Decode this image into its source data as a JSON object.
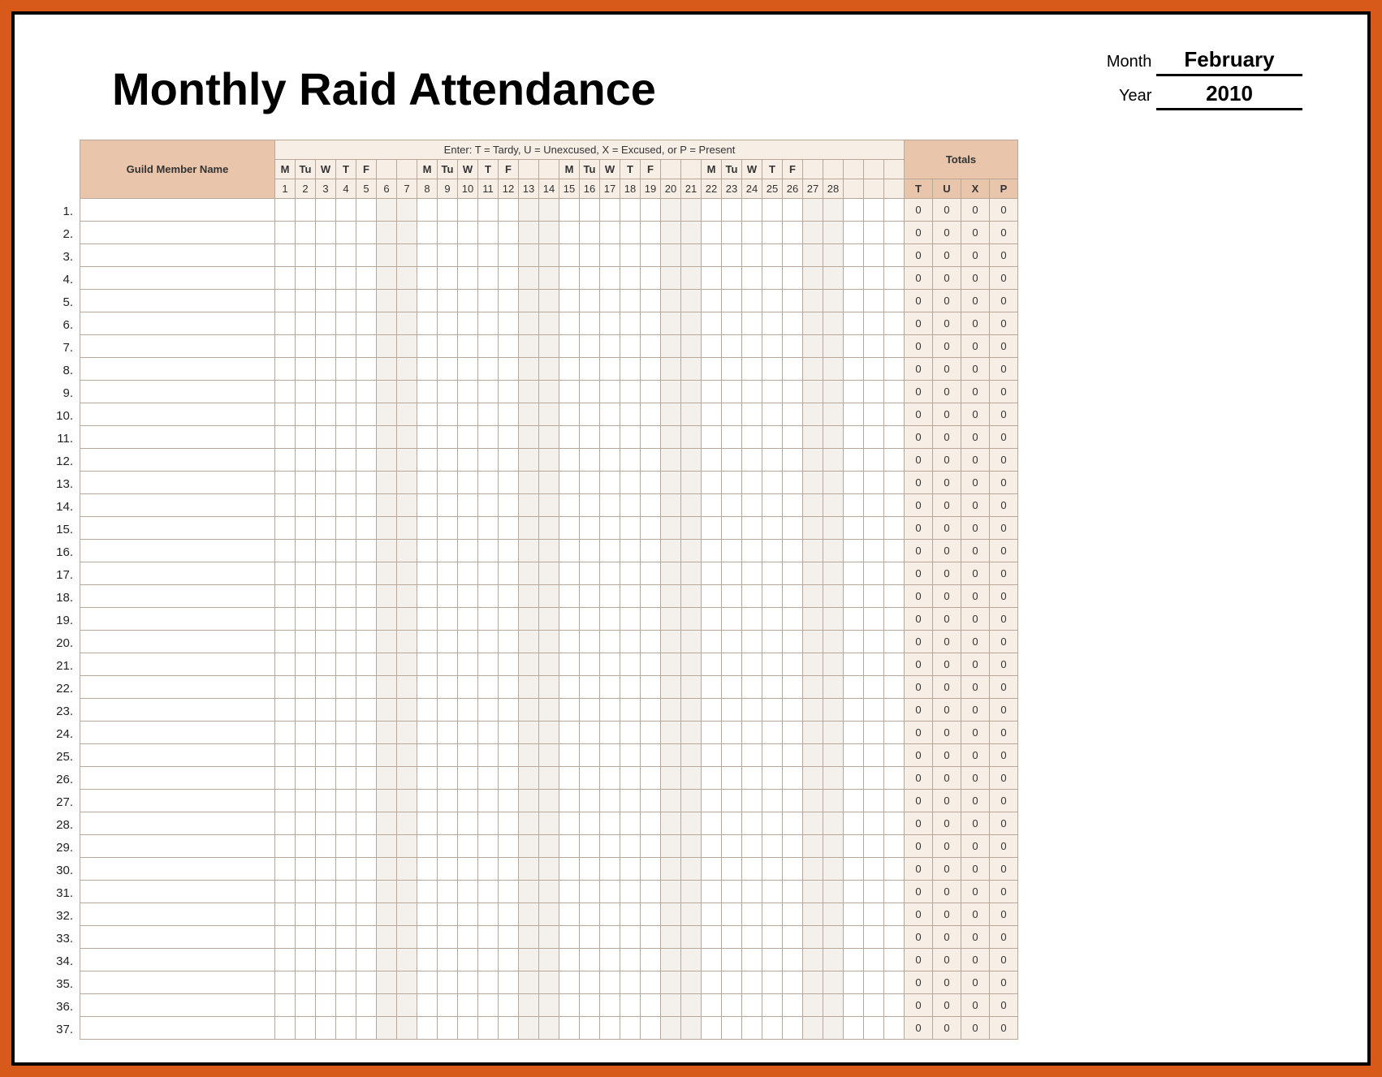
{
  "title": "Monthly Raid Attendance",
  "meta": {
    "month_label": "Month",
    "month_value": "February",
    "year_label": "Year",
    "year_value": "2010"
  },
  "headers": {
    "name": "Guild Member Name",
    "enter_note": "Enter:  T = Tardy,   U = Unexcused,   X = Excused,   or P = Present",
    "totals": "Totals"
  },
  "days": [
    {
      "dow": "M",
      "num": "1",
      "weekend": false
    },
    {
      "dow": "Tu",
      "num": "2",
      "weekend": false
    },
    {
      "dow": "W",
      "num": "3",
      "weekend": false
    },
    {
      "dow": "T",
      "num": "4",
      "weekend": false
    },
    {
      "dow": "F",
      "num": "5",
      "weekend": false
    },
    {
      "dow": "",
      "num": "6",
      "weekend": true
    },
    {
      "dow": "",
      "num": "7",
      "weekend": true
    },
    {
      "dow": "M",
      "num": "8",
      "weekend": false
    },
    {
      "dow": "Tu",
      "num": "9",
      "weekend": false
    },
    {
      "dow": "W",
      "num": "10",
      "weekend": false
    },
    {
      "dow": "T",
      "num": "11",
      "weekend": false
    },
    {
      "dow": "F",
      "num": "12",
      "weekend": false
    },
    {
      "dow": "",
      "num": "13",
      "weekend": true
    },
    {
      "dow": "",
      "num": "14",
      "weekend": true
    },
    {
      "dow": "M",
      "num": "15",
      "weekend": false
    },
    {
      "dow": "Tu",
      "num": "16",
      "weekend": false
    },
    {
      "dow": "W",
      "num": "17",
      "weekend": false
    },
    {
      "dow": "T",
      "num": "18",
      "weekend": false
    },
    {
      "dow": "F",
      "num": "19",
      "weekend": false
    },
    {
      "dow": "",
      "num": "20",
      "weekend": true
    },
    {
      "dow": "",
      "num": "21",
      "weekend": true
    },
    {
      "dow": "M",
      "num": "22",
      "weekend": false
    },
    {
      "dow": "Tu",
      "num": "23",
      "weekend": false
    },
    {
      "dow": "W",
      "num": "24",
      "weekend": false
    },
    {
      "dow": "T",
      "num": "25",
      "weekend": false
    },
    {
      "dow": "F",
      "num": "26",
      "weekend": false
    },
    {
      "dow": "",
      "num": "27",
      "weekend": true
    },
    {
      "dow": "",
      "num": "28",
      "weekend": true
    },
    {
      "dow": "",
      "num": "",
      "weekend": false
    },
    {
      "dow": "",
      "num": "",
      "weekend": false
    },
    {
      "dow": "",
      "num": "",
      "weekend": false
    }
  ],
  "total_codes": [
    "T",
    "U",
    "X",
    "P"
  ],
  "num_rows": 37,
  "row_numbers": [
    "1.",
    "2.",
    "3.",
    "4.",
    "5.",
    "6.",
    "7.",
    "8.",
    "9.",
    "10.",
    "11.",
    "12.",
    "13.",
    "14.",
    "15.",
    "16.",
    "17.",
    "18.",
    "19.",
    "20.",
    "21.",
    "22.",
    "23.",
    "24.",
    "25.",
    "26.",
    "27.",
    "28.",
    "29.",
    "30.",
    "31.",
    "32.",
    "33.",
    "34.",
    "35.",
    "36.",
    "37."
  ],
  "default_total": "0"
}
